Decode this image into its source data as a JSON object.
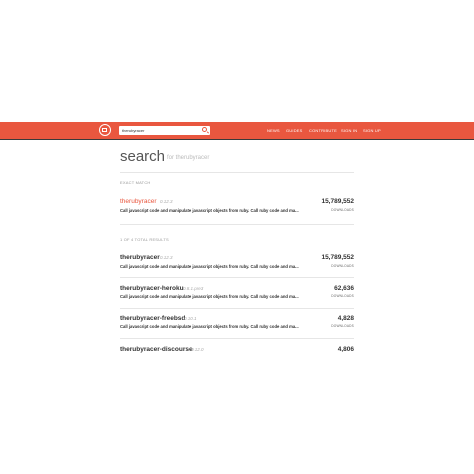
{
  "header": {
    "search_value": "therubyracer",
    "nav": [
      "NEWS",
      "GUIDES",
      "CONTRIBUTE",
      "SIGN IN",
      "SIGN UP"
    ],
    "brand_color": "#e9573f"
  },
  "page": {
    "title": "search",
    "subtitle": "for therubyracer"
  },
  "exact_match": {
    "label": "EXACT MATCH",
    "gem": {
      "name": "therubyracer",
      "version": "0.12.3",
      "description": "Call javascript code and manipulate javascript objects from ruby. Call ruby code and ma...",
      "downloads": "15,789,552",
      "downloads_label": "DOWNLOADS"
    }
  },
  "results": {
    "label": "1 OF 4 TOTAL RESULTS",
    "items": [
      {
        "name": "therubyracer",
        "version": "0.12.3",
        "description": "Call javascript code and manipulate javascript objects from ruby. Call ruby code and ma...",
        "downloads": "15,789,552",
        "downloads_label": "DOWNLOADS"
      },
      {
        "name": "therubyracer-heroku",
        "version": "0.8.1.pre3",
        "description": "Call javascript code and manipulate javascript objects from ruby. Call ruby code and ma...",
        "downloads": "62,636",
        "downloads_label": "DOWNLOADS"
      },
      {
        "name": "therubyracer-freebsd",
        "version": "0.10.1",
        "description": "Call javascript code and manipulate javascript objects from ruby. Call ruby code and ma...",
        "downloads": "4,828",
        "downloads_label": "DOWNLOADS"
      },
      {
        "name": "therubyracer-discourse",
        "version": "0.12.0",
        "downloads": "4,806"
      }
    ]
  }
}
